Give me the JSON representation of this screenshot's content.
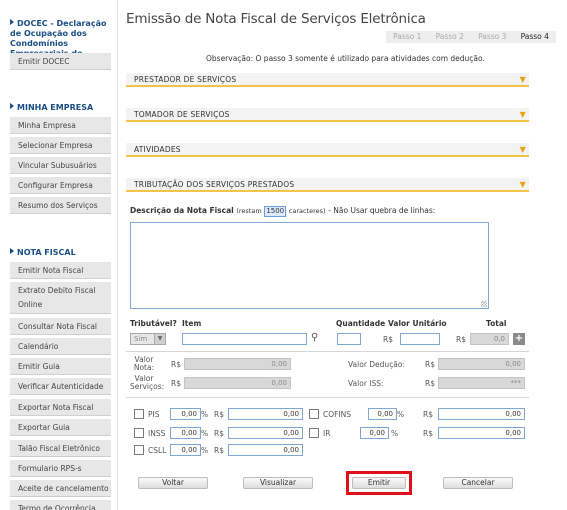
{
  "sidebar": {
    "docec": {
      "title": "DOCEC - Declaração de Ocupação dos Condomínios Empresariais de Campinas",
      "items": [
        "Emitir DOCEC"
      ]
    },
    "empresa": {
      "title": "MINHA EMPRESA",
      "items": [
        "Minha Empresa",
        "Selecionar Empresa",
        "Vincular Subusuários",
        "Configurar Empresa",
        "Resumo dos Serviços"
      ]
    },
    "nota": {
      "title": "NOTA FISCAL",
      "items": [
        "Emitir Nota Fiscal",
        "Extrato Debito Fiscal Online",
        "Consultar Nota Fiscal",
        "Calendário",
        "Emitir Guia",
        "Verificar Autenticidade",
        "Exportar Nota Fiscal",
        "Exportar Guia",
        "Talão Fiscal Eletrônico",
        "Formulario RPS-s",
        "Aceite de cancelamento",
        "Termo de Ocorrência"
      ]
    }
  },
  "main": {
    "title": "Emissão de Nota Fiscal de Serviços Eletrônica",
    "steps": [
      "Passo 1",
      "Passo 2",
      "Passo 3",
      "Passo 4"
    ],
    "active_step": "Passo 4",
    "observation": "Observação: O passo 3 somente é utilizado para atividades com dedução.",
    "sections": [
      "PRESTADOR DE SERVIÇOS",
      "TOMADOR DE SERVIÇOS",
      "ATIVIDADES",
      "TRIBUTAÇÃO DOS SERVIÇOS PRESTADOS"
    ],
    "description": {
      "label": "Descrição da Nota Fiscal",
      "restam": "(restam",
      "count": "1500",
      "caracteres": "caracteres)",
      "hint": "- Não Usar quebra de linhas:",
      "value": ""
    },
    "items_header": {
      "tributavel": "Tributável?",
      "item": "Item",
      "quantidade": "Quantidade",
      "valor_unitario": "Valor Unitário",
      "total": "Total"
    },
    "item_row": {
      "tributavel_value": "Sim",
      "item_value": "",
      "quantidade_value": "",
      "valor_unitario_currency": "R$",
      "valor_unitario_value": "",
      "total_currency": "R$",
      "total_value": "0,0"
    },
    "totals": {
      "valor_nota_label": "Valor Nota:",
      "valor_nota_currency": "R$",
      "valor_nota_value": "0,00",
      "valor_deducao_label": "Valor Dedução:",
      "valor_deducao_currency": "R$",
      "valor_deducao_value": "0,00",
      "valor_servicos_label": "Valor Serviços:",
      "valor_servicos_currency": "R$",
      "valor_servicos_value": "0,00",
      "valor_iss_label": "Valor ISS:",
      "valor_iss_currency": "R$",
      "valor_iss_value": "***"
    },
    "taxes": [
      {
        "name": "PIS",
        "percent": "0,00",
        "currency": "R$",
        "value": "0,00"
      },
      {
        "name": "COFINS",
        "percent": "0,00",
        "currency": "R$",
        "value": "0,00"
      },
      {
        "name": "INSS",
        "percent": "0,00",
        "currency": "R$",
        "value": "0,00"
      },
      {
        "name": "IR",
        "percent": "0,00",
        "currency": "R$",
        "value": "0,00"
      },
      {
        "name": "CSLL",
        "percent": "0,00",
        "currency": "R$",
        "value": "0,00"
      }
    ],
    "percent_sign": "%",
    "buttons": {
      "voltar": "Voltar",
      "visualizar": "Visualizar",
      "emitir": "Emitir",
      "cancelar": "Cancelar"
    }
  },
  "colors": {
    "accent": "#1a4f86",
    "section_border": "#f2c54a",
    "highlight": "#e0101b"
  },
  "icons": [
    "search-icon",
    "plus-icon",
    "chevron-down-icon",
    "bullet-arrow-icon"
  ]
}
